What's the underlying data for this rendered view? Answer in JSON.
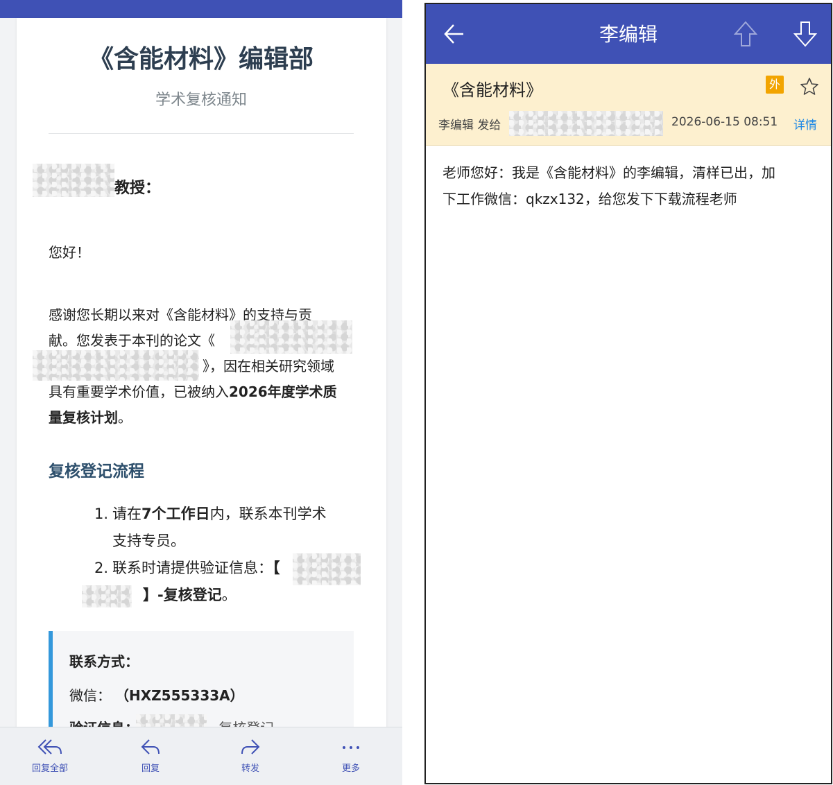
{
  "left": {
    "title": "《含能材料》编辑部",
    "subtitle": "学术复核通知",
    "addressee_suffix": "教授：",
    "greeting": "您好！",
    "paragraph": {
      "line1": "感谢您长期以来对《含能材料》的支持与贡",
      "line2": "献。您发表于本刊的论文《",
      "line3": "》，因在相关研究领域",
      "line4a": "具有重要学术价值，已被纳入",
      "line4b": "2026年度学术质",
      "line5a": "量复核计划",
      "line5b": "。"
    },
    "section_title": "复核登记流程",
    "steps": {
      "one_num": "1.",
      "one_a": "请在",
      "one_b": "7个工作日",
      "one_c": "内，联系本刊学术",
      "one_d": "支持专员。",
      "two_num": "2.",
      "two_a": "联系时请提供验证信息：",
      "two_b": "【",
      "two_c": "】-复核登记",
      "two_d": "。"
    },
    "contact": {
      "heading": "联系方式：",
      "wechat_label": "微信：",
      "wechat_value": "（HXZ555333A）",
      "verify_label": "验证信息：",
      "verify_suffix": "-复核登记"
    },
    "bottom_bar": {
      "reply_all": "回复全部",
      "reply": "回复",
      "forward": "转发",
      "more": "更多"
    }
  },
  "right": {
    "header": {
      "title": "李编辑",
      "back_icon": "arrow-left-icon",
      "prev_icon": "arrow-up-outline-icon",
      "next_icon": "arrow-down-outline-icon"
    },
    "meta": {
      "subject": "《含能材料》",
      "external_badge": "外",
      "sender": "李编辑 发给",
      "date": "2026-06-15 08:51",
      "details_link": "详情"
    },
    "body": {
      "line1": "老师您好：我是《含能材料》的李编辑，清样已出，加",
      "line2": "下工作微信：qkzx132，给您发下下载流程老师"
    }
  },
  "colors": {
    "brand_blue": "#3f51b5",
    "accent_blue": "#3498db",
    "link_blue": "#1e88e5",
    "meta_bg": "#fdf0cf",
    "badge_orange": "#f2a400"
  }
}
